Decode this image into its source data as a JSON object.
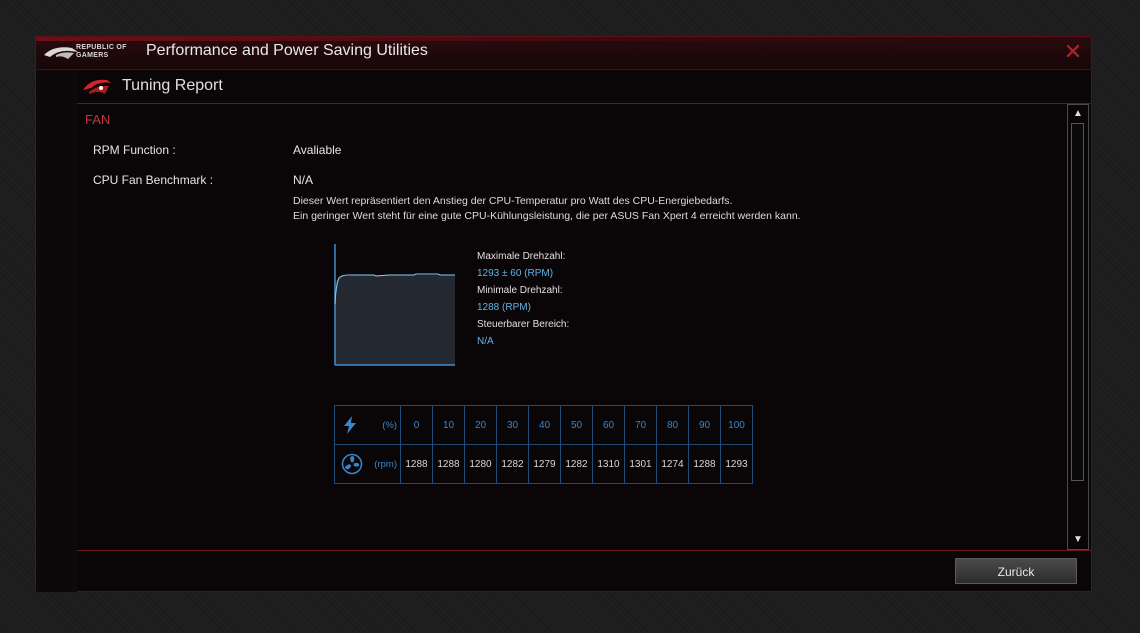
{
  "window": {
    "logo_text_line1": "REPUBLIC OF",
    "logo_text_line2": "GAMERS",
    "title": "Performance and Power Saving Utilities",
    "close_glyph": "✕"
  },
  "subheader": {
    "title": "Tuning Report",
    "icon": "rog-eye-icon"
  },
  "section": {
    "label": "FAN",
    "rpm_function_label": "RPM Function :",
    "rpm_function_value": "Avaliable",
    "benchmark_label": "CPU Fan Benchmark :",
    "benchmark_value": "N/A",
    "desc_line1": "Dieser Wert repräsentiert den Anstieg der CPU-Temperatur pro Watt des CPU-Energiebedarfs.",
    "desc_line2": "Ein geringer Wert steht für eine gute CPU-Kühlungsleistung, die per ASUS Fan Xpert 4 erreicht werden kann."
  },
  "stats": {
    "max_label": "Maximale Drehzahl:",
    "max_value": "1293 ± 60 (RPM)",
    "min_label": "Minimale Drehzahl:",
    "min_value": "1288 (RPM)",
    "range_label": "Steuerbarer Bereich:",
    "range_value": "N/A"
  },
  "table": {
    "percent_unit": "(%)",
    "rpm_unit": "(rpm)",
    "percent": [
      "0",
      "10",
      "20",
      "30",
      "40",
      "50",
      "60",
      "70",
      "80",
      "90",
      "100"
    ],
    "rpm": [
      "1288",
      "1288",
      "1280",
      "1282",
      "1279",
      "1282",
      "1310",
      "1301",
      "1274",
      "1288",
      "1293"
    ],
    "percent_icon": "lightning-icon",
    "rpm_icon": "fan-icon"
  },
  "colors": {
    "accent_red": "#c8323c",
    "accent_blue": "#5fb4e8",
    "table_border": "#1f4d78"
  },
  "footer": {
    "back_label": "Zurück"
  },
  "scrollbar": {
    "up_glyph": "▲",
    "down_glyph": "▼"
  }
}
